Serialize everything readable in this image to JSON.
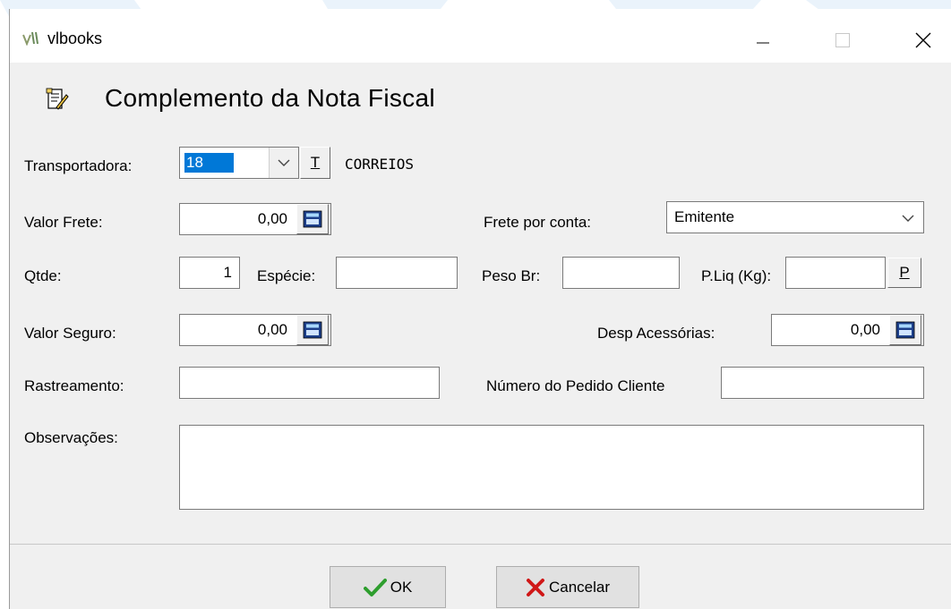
{
  "window": {
    "title": "vlbooks"
  },
  "heading": "Complemento da Nota Fiscal",
  "transportadora": {
    "label": "Transportadora:",
    "code": "18",
    "t_button": "T",
    "name": "CORREIOS"
  },
  "valor_frete": {
    "label": "Valor Frete:",
    "value": "0,00"
  },
  "frete_por_conta": {
    "label": "Frete por conta:",
    "value": "Emitente"
  },
  "qtde": {
    "label": "Qtde:",
    "value": "1"
  },
  "especie": {
    "label": "Espécie:",
    "value": ""
  },
  "peso_br": {
    "label": "Peso Br:",
    "value": ""
  },
  "p_liq": {
    "label": "P.Liq (Kg):",
    "value": "",
    "p_button": "P"
  },
  "valor_seguro": {
    "label": "Valor Seguro:",
    "value": "0,00"
  },
  "desp_acessorias": {
    "label": "Desp Acessórias:",
    "value": "0,00"
  },
  "rastreamento": {
    "label": "Rastreamento:",
    "value": ""
  },
  "numero_pedido": {
    "label": "Número do Pedido Cliente",
    "value": ""
  },
  "observacoes": {
    "label": "Observações:",
    "value": ""
  },
  "buttons": {
    "ok": "OK",
    "cancel": "Cancelar"
  },
  "colors": {
    "selection": "#0078d7",
    "ok_check": "#2e9e2e",
    "cancel_x": "#d01818"
  }
}
